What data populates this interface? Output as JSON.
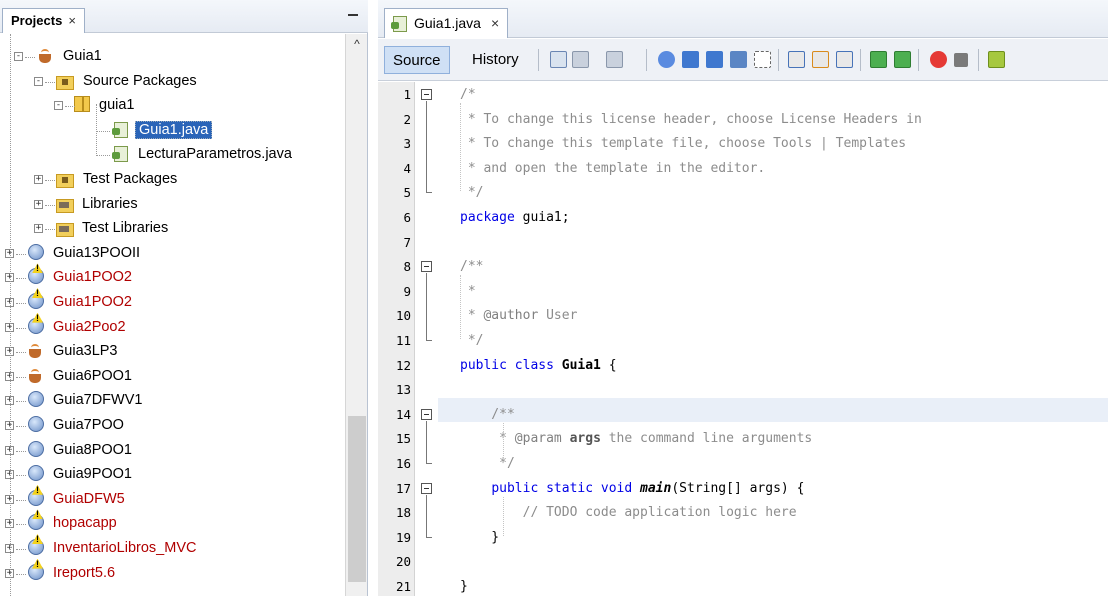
{
  "projects_panel": {
    "tab_label": "Projects",
    "close_glyph": "×",
    "minimize_glyph": "—",
    "tree": [
      {
        "label": "Guia1",
        "icon": "coffee-cup-icon",
        "indent": 1,
        "expanded": true,
        "red": false
      },
      {
        "label": "Source Packages",
        "icon": "source-packages-icon",
        "indent": 2,
        "expanded": true,
        "red": false
      },
      {
        "label": "guia1",
        "icon": "package-icon",
        "indent": 3,
        "expanded": true,
        "red": false
      },
      {
        "label": "Guia1.java",
        "icon": "java-file-icon",
        "indent": 4,
        "selected": true,
        "red": false
      },
      {
        "label": "LecturaParametros.java",
        "icon": "java-file-icon",
        "indent": 4,
        "red": false
      },
      {
        "label": "Test Packages",
        "icon": "test-packages-icon",
        "indent": 2,
        "expanded": false,
        "red": false
      },
      {
        "label": "Libraries",
        "icon": "libraries-icon",
        "indent": 2,
        "expanded": false,
        "red": false
      },
      {
        "label": "Test Libraries",
        "icon": "test-libraries-icon",
        "indent": 2,
        "expanded": false,
        "red": false
      },
      {
        "label": "Guia13POOII",
        "icon": "globe-icon",
        "indent": 0,
        "red": false
      },
      {
        "label": "Guia1POO2",
        "icon": "globe-warning-icon",
        "indent": 0,
        "red": true
      },
      {
        "label": "Guia1POO2",
        "icon": "globe-warning-icon",
        "indent": 0,
        "red": true
      },
      {
        "label": "Guia2Poo2",
        "icon": "globe-warning-icon",
        "indent": 0,
        "red": true
      },
      {
        "label": "Guia3LP3",
        "icon": "coffee-cup-icon",
        "indent": 0,
        "red": false
      },
      {
        "label": "Guia6POO1",
        "icon": "coffee-cup-icon",
        "indent": 0,
        "red": false
      },
      {
        "label": "Guia7DFWV1",
        "icon": "globe-icon",
        "indent": 0,
        "red": false
      },
      {
        "label": "Guia7POO",
        "icon": "globe-icon",
        "indent": 0,
        "red": false
      },
      {
        "label": "Guia8POO1",
        "icon": "globe-icon",
        "indent": 0,
        "red": false
      },
      {
        "label": "Guia9POO1",
        "icon": "globe-icon",
        "indent": 0,
        "red": false
      },
      {
        "label": "GuiaDFW5",
        "icon": "globe-warning-icon",
        "indent": 0,
        "red": true
      },
      {
        "label": "hopacapp",
        "icon": "globe-warning-icon",
        "indent": 0,
        "red": true
      },
      {
        "label": "InventarioLibros_MVC",
        "icon": "globe-warning-icon",
        "indent": 0,
        "red": true
      },
      {
        "label": "Ireport5.6",
        "icon": "globe-warning-icon",
        "indent": 0,
        "red": true
      }
    ]
  },
  "editor": {
    "file_tab": {
      "label": "Guia1.java",
      "close_glyph": "×"
    },
    "toolbar": {
      "source_label": "Source",
      "history_label": "History"
    },
    "lines": [
      {
        "n": "1",
        "text": "/*",
        "cls": "cm"
      },
      {
        "n": "2",
        "text": " * To change this license header, choose License Headers in",
        "cls": "cm"
      },
      {
        "n": "3",
        "text": " * To change this template file, choose Tools | Templates",
        "cls": "cm"
      },
      {
        "n": "4",
        "text": " * and open the template in the editor.",
        "cls": "cm"
      },
      {
        "n": "5",
        "text": " */",
        "cls": "cm"
      },
      {
        "n": "6",
        "text": "package guia1;",
        "cls": "pkg"
      },
      {
        "n": "7",
        "text": "",
        "cls": ""
      },
      {
        "n": "8",
        "text": "/**",
        "cls": "cm"
      },
      {
        "n": "9",
        "text": " *",
        "cls": "cm"
      },
      {
        "n": "10",
        "text": " * @author User",
        "cls": "author"
      },
      {
        "n": "11",
        "text": " */",
        "cls": "cm"
      },
      {
        "n": "12",
        "text": "public class Guia1 {",
        "cls": "class"
      },
      {
        "n": "13",
        "text": "",
        "cls": ""
      },
      {
        "n": "14",
        "text": "    /**",
        "cls": "cm"
      },
      {
        "n": "15",
        "text": "     * @param args the command line arguments",
        "cls": "param"
      },
      {
        "n": "16",
        "text": "     */",
        "cls": "cm"
      },
      {
        "n": "17",
        "text": "    public static void main(String[] args) {",
        "cls": "main"
      },
      {
        "n": "18",
        "text": "        // TODO code application logic here",
        "cls": "cm"
      },
      {
        "n": "19",
        "text": "    }",
        "cls": ""
      },
      {
        "n": "20",
        "text": "",
        "cls": ""
      },
      {
        "n": "21",
        "text": "}",
        "cls": ""
      }
    ]
  }
}
